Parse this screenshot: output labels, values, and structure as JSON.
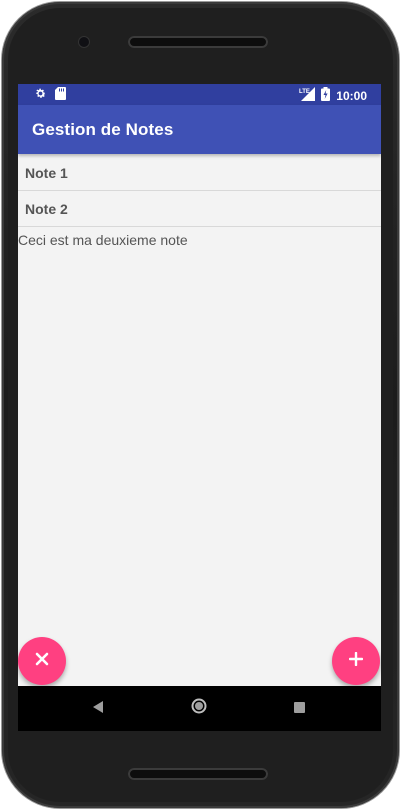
{
  "statusbar": {
    "time": "10:00",
    "left_icons": [
      "settings-icon",
      "sd-card-icon"
    ],
    "right_icons": [
      "lte-signal-icon",
      "battery-charging-icon"
    ],
    "network_label": "LTE"
  },
  "appbar": {
    "title": "Gestion de Notes"
  },
  "notes": [
    {
      "label": "Note 1"
    },
    {
      "label": "Note 2"
    }
  ],
  "note_content": "Ceci est ma deuxieme note",
  "fabs": {
    "delete_icon": "close-icon",
    "add_icon": "plus-icon"
  },
  "navbar": {
    "buttons": [
      "back-icon",
      "home-icon",
      "recents-icon"
    ]
  },
  "colors": {
    "statusbar": "#303f9f",
    "appbar": "#3f51b5",
    "accent": "#ff4081",
    "background": "#f3f3f3"
  }
}
